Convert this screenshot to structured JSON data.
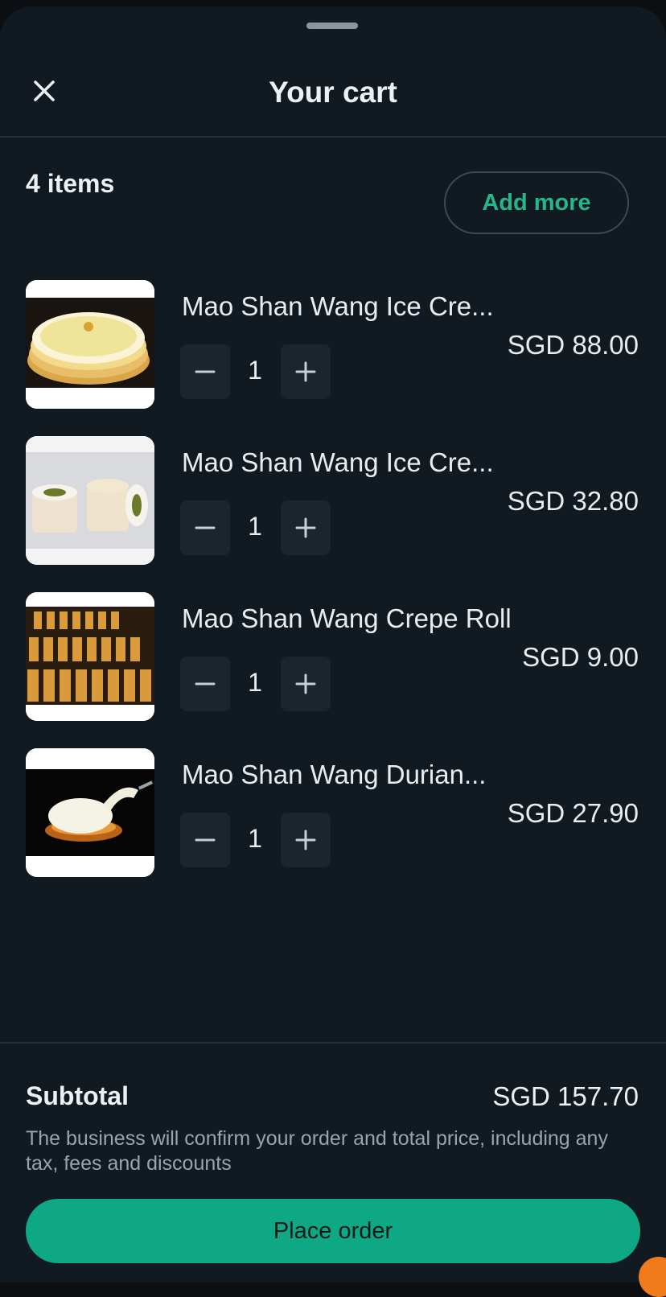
{
  "header": {
    "title": "Your cart",
    "close_icon": "close-icon"
  },
  "summary": {
    "items_count": "4 items",
    "add_more_label": "Add more"
  },
  "items": [
    {
      "name": "Mao Shan Wang Ice Cre...",
      "price": "SGD 88.00",
      "quantity": "1",
      "image": "durian-crepe-cake"
    },
    {
      "name": "Mao Shan Wang Ice Cre...",
      "price": "SGD 32.80",
      "quantity": "1",
      "image": "ice-cream-tubs"
    },
    {
      "name": "Mao Shan Wang Crepe Roll",
      "price": "SGD 9.00",
      "quantity": "1",
      "image": "crepe-rolls-tray"
    },
    {
      "name": "Mao Shan Wang Durian...",
      "price": "SGD 27.90",
      "quantity": "1",
      "image": "durian-mochi"
    }
  ],
  "footer": {
    "subtotal_label": "Subtotal",
    "subtotal_value": "SGD 157.70",
    "disclaimer": "The business will confirm your order and total price, including any tax, fees and discounts",
    "place_order_label": "Place order"
  },
  "colors": {
    "background": "#121a21",
    "accent": "#0fa884",
    "accent_text": "#25b68a",
    "text": "#eef1f3",
    "muted": "#9aa4ab"
  }
}
